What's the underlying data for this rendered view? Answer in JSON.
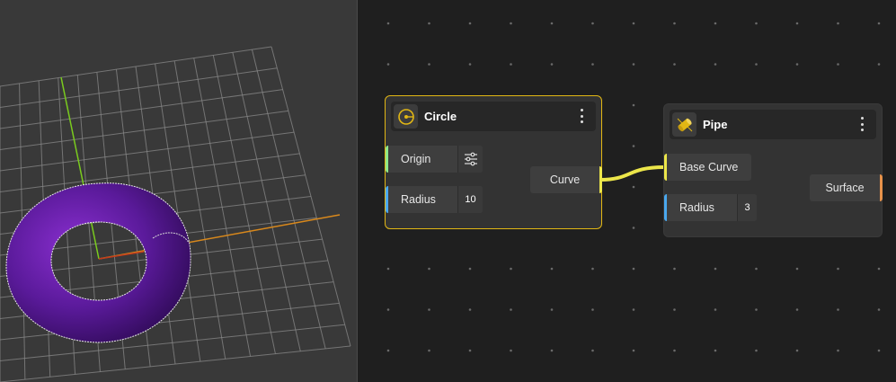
{
  "viewport": {
    "mesh_color": "#5a1a9a",
    "grid_color": "#8a8a8a",
    "axis_colors": {
      "y": "#7acb1e",
      "x": "#d8881c"
    }
  },
  "editor": {
    "wire_color": "#ece64a",
    "nodes": {
      "circle": {
        "title": "Circle",
        "icon": "circle-icon",
        "inputs": [
          {
            "label": "Origin",
            "color": "#8ee88a",
            "control": "sliders-icon"
          },
          {
            "label": "Radius",
            "color": "#4aa8ee",
            "value": "10"
          }
        ],
        "output": {
          "label": "Curve",
          "color": "#ece64a"
        }
      },
      "pipe": {
        "title": "Pipe",
        "icon": "pipe-icon",
        "inputs": [
          {
            "label": "Base Curve",
            "color": "#ece64a"
          },
          {
            "label": "Radius",
            "color": "#4aa8ee",
            "value": "3"
          }
        ],
        "output": {
          "label": "Surface",
          "color": "#e8924a"
        }
      }
    }
  }
}
